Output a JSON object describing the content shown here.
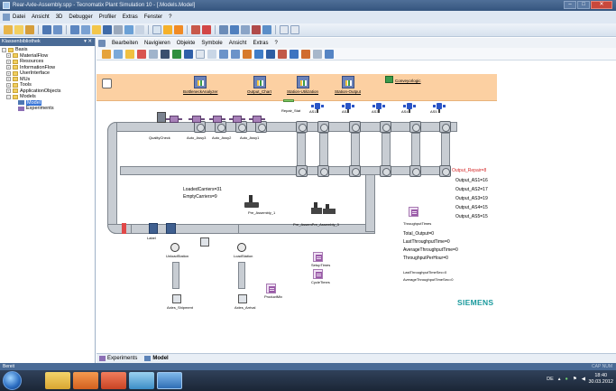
{
  "titlebar": {
    "title": "Rear-Axle-Assembly.spp - Tecnomatix Plant Simulation 10 - [.Models.Model]",
    "buttons": [
      "–",
      "□",
      "✕"
    ]
  },
  "menubar": {
    "items": [
      "Datei",
      "Ansicht",
      "3D",
      "Debugger",
      "Profiler",
      "Extras",
      "Fenster",
      "?"
    ]
  },
  "panel": {
    "title": "Klassenbibliothek",
    "pin": "▾ ✕",
    "tree": [
      {
        "label": "Basis",
        "level": 0
      },
      {
        "label": "MaterialFlow",
        "level": 1
      },
      {
        "label": "Resources",
        "level": 1
      },
      {
        "label": "InformationFlow",
        "level": 1
      },
      {
        "label": "UserInterface",
        "level": 1
      },
      {
        "label": "MUs",
        "level": 1
      },
      {
        "label": "Tools",
        "level": 1
      },
      {
        "label": "ApplicationObjects",
        "level": 1
      },
      {
        "label": "Models",
        "level": 1
      },
      {
        "label": "Model",
        "level": 2
      },
      {
        "label": "Experiments",
        "level": 2
      }
    ]
  },
  "doc": {
    "menu": [
      "Bearbeiten",
      "Navigieren",
      "Objekte",
      "Symbole",
      "Ansicht",
      "Extras",
      "?"
    ],
    "tabs": [
      {
        "label": "Experiments"
      },
      {
        "label": "Model"
      }
    ]
  },
  "model": {
    "charts": [
      {
        "label": "BottleneckAnalyzer"
      },
      {
        "label": "Output_Chart"
      },
      {
        "label": "Station-Utilization"
      },
      {
        "label": "Station-Output"
      }
    ],
    "conveyor_label": "Conveyorlogic",
    "stations_top": [
      "Repair_Stat",
      "AS1",
      "AS2",
      "AS3",
      "AS4",
      "AS5"
    ],
    "robots": [
      "QualityCheck",
      "Auto_Assy3",
      "Auto_Assy2",
      "Auto_Assy1"
    ],
    "mid_labels": {
      "loaded": "LoadedCarriers=31",
      "empty": "EmptyCarriers=9",
      "pre1": "Pre_Assembly_1",
      "pre3": "Pre_AssemPre_Assembly_3",
      "label": "Label"
    },
    "lower_labels": {
      "unload": "UnloadStation",
      "loadst": "LoadStation",
      "setup": "SetupTimes",
      "cycle": "CycleTimes",
      "productmix": "ProductMix",
      "ship": "Axles_Shipment",
      "arrival": "Axles_Arrival",
      "throughput": "ThroughputTimes"
    },
    "outputs": {
      "repair": "Output_Repair=8",
      "as1": "Output_AS1=16",
      "as2": "Output_AS2=17",
      "as3": "Output_AS3=19",
      "as4": "Output_AS4=15",
      "as5": "Output_AS5=15"
    },
    "stats": {
      "total": "Total_Output=0",
      "last": "LastThroughputTime=0",
      "avg": "AverageThroughputTime=0",
      "tph": "ThroughputPerHour=0",
      "lastsec": "LastThroughputTimeSec=0",
      "avgsec": "AverageThroughputTimeSec=0"
    },
    "brand": "SIEMENS"
  },
  "statusbar": {
    "text": "Bereit",
    "cap": "CAP NUM"
  },
  "taskbar": {
    "lang": "DE",
    "time": "18:40",
    "date": "30.03.2012"
  },
  "colors": {
    "accent": "#4a6b96",
    "orange_panel": "#fcd0a2",
    "brand": "#1a9a9d",
    "output_red": "#d42626"
  }
}
